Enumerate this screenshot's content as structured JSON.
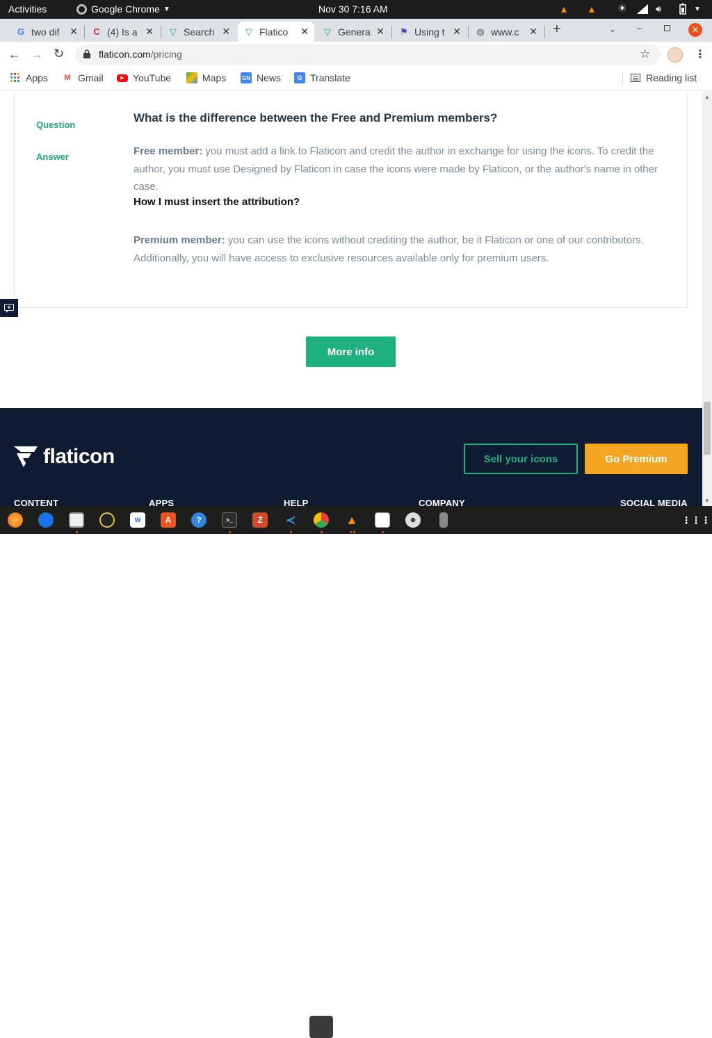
{
  "system": {
    "activities": "Activities",
    "app_name": "Google Chrome",
    "clock": "Nov 30  7:16 AM"
  },
  "tabs": [
    {
      "title": "two dif",
      "icon": "google-icon",
      "color": "#4285f4"
    },
    {
      "title": "(4) Is a",
      "icon": "quora-c-icon",
      "color": "#d62d20"
    },
    {
      "title": "Search",
      "icon": "flaticon-icon",
      "color": "#1fb07f"
    },
    {
      "title": "Flatico",
      "icon": "flaticon-icon",
      "color": "#1fb07f"
    },
    {
      "title": "Genera",
      "icon": "flaticon-icon",
      "color": "#1fb07f"
    },
    {
      "title": "Using t",
      "icon": "flag-icon",
      "color": "#3f51b5"
    },
    {
      "title": "www.c",
      "icon": "globe-icon",
      "color": "#5f6368"
    }
  ],
  "address": {
    "domain": "flaticon.com",
    "path": "/pricing"
  },
  "bookmarks": {
    "items": [
      {
        "label": "Apps"
      },
      {
        "label": "Gmail"
      },
      {
        "label": "YouTube"
      },
      {
        "label": "Maps"
      },
      {
        "label": "News"
      },
      {
        "label": "Translate"
      }
    ],
    "reading_list": "Reading list"
  },
  "faq": {
    "question_label": "Question",
    "answer_label": "Answer",
    "question": "What is the difference between the Free and Premium members?",
    "free_title": "Free member:",
    "free_text": " you must add a link to Flaticon and credit the author in exchange for using the icons. To credit the author, you must use Designed by Flaticon in case the icons were made by Flaticon, or the author's name in other case.",
    "howto": "How I must insert the attribution?",
    "premium_title": "Premium member:",
    "premium_text": " you can use the icons without crediting the author, be it Flaticon or one of our contributors. Additionally, you will have access to exclusive resources available only for premium users."
  },
  "more_info": "More info",
  "footer": {
    "logo_text": "flaticon",
    "sell_label": "Sell your icons",
    "premium_label": "Go Premium",
    "columns": [
      "CONTENT",
      "APPS",
      "HELP",
      "COMPANY",
      "SOCIAL MEDIA"
    ]
  },
  "colors": {
    "accent_green": "#1fb07f",
    "premium_orange": "#f4a623",
    "footer_navy": "#0f1b33"
  }
}
